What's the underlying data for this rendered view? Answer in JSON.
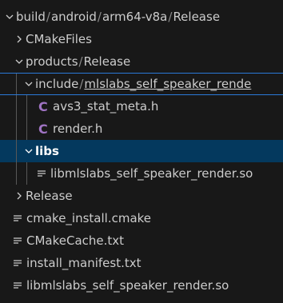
{
  "explorer": {
    "root": {
      "segments": [
        "build",
        "android",
        "arm64-v8a",
        "Release"
      ],
      "separator": "/"
    },
    "cmake_files": {
      "label": "CMakeFiles"
    },
    "products": {
      "segments": [
        "products",
        "Release"
      ]
    },
    "include": {
      "segments": [
        "include",
        "mlslabs_self_speaker_rende"
      ]
    },
    "avs3_stat_meta": {
      "icon": "C",
      "label": "avs3_stat_meta.h"
    },
    "render_h": {
      "icon": "C",
      "label": "render.h"
    },
    "libs": {
      "label": "libs"
    },
    "libs_so": {
      "label": "libmlslabs_self_speaker_render.so"
    },
    "release": {
      "label": "Release"
    },
    "cmake_install": {
      "label": "cmake_install.cmake"
    },
    "cmake_cache": {
      "label": "CMakeCache.txt"
    },
    "install_manifest": {
      "label": "install_manifest.txt"
    },
    "root_so": {
      "label": "libmlslabs_self_speaker_render.so"
    }
  },
  "colors": {
    "background": "#181818",
    "selection": "#04395e",
    "focus_outline": "#2b79d8",
    "c_icon": "#a074c4",
    "text": "#cccccc"
  },
  "icons": [
    "chevron-down-icon",
    "chevron-right-icon",
    "c-file-icon",
    "lines-file-icon"
  ]
}
